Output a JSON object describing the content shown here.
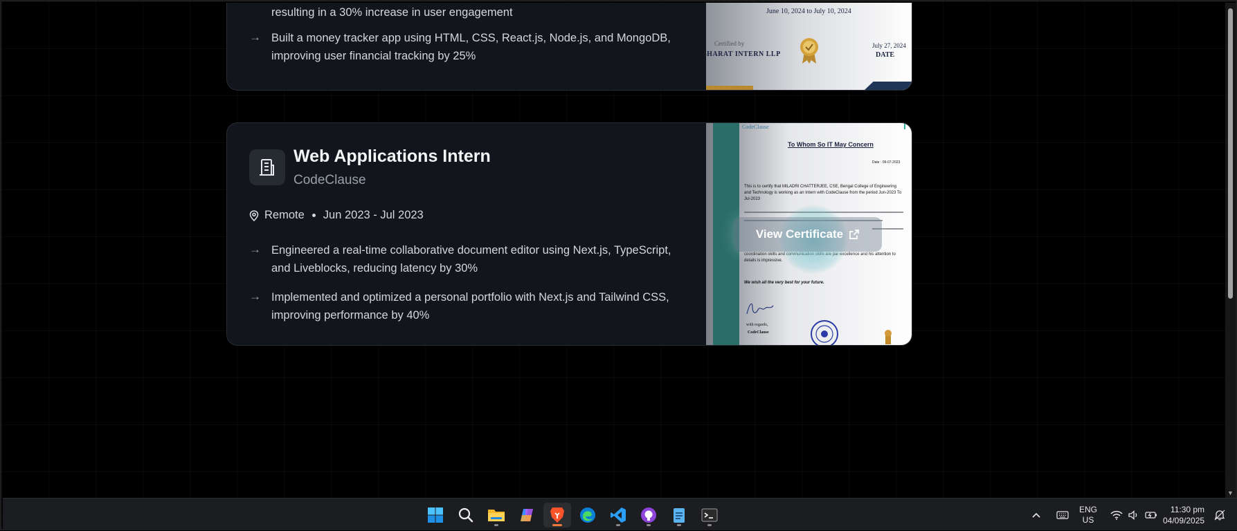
{
  "experience_prev": {
    "bullets": [
      "resulting in a 30% increase in user engagement",
      "Built a money tracker app using HTML, CSS, React.js, Node.js, and MongoDB, improving user financial tracking by 25%"
    ],
    "certificate": {
      "dates": "June 10, 2024 to July 10, 2024",
      "certified_by_label": "Certified by",
      "issuer": "BHARAT INTERN LLP",
      "date_value": "July 27, 2024",
      "date_label": "DATE"
    }
  },
  "experience": {
    "role": "Web Applications Intern",
    "company": "CodeClause",
    "location": "Remote",
    "period": "Jun 2023 - Jul 2023",
    "bullets": [
      "Engineered a real-time collaborative document editor using Next.js, TypeScript, and Liveblocks, reducing latency by 30%",
      "Implemented and optimized a personal portfolio with Next.js and Tailwind CSS, improving performance by 40%"
    ],
    "certificate": {
      "brand": "CodeClause",
      "heading": "To Whom So IT May Concern",
      "date_line": "Date : 09-07-2023",
      "body": "This is to certify that MILADRI CHATTERJEE, CSE, Bengal College of Engineering and Technology is working as an Intern with CodeClause from the period Jun-2023 To Jul-2023",
      "body2": "coordination skills and communication skills are par excellence and his attention to details is impressive.",
      "wish": "We wish all the very best for your future.",
      "regards": "with regards,",
      "signoff": "CodeClause",
      "view_label": "View Certificate"
    }
  },
  "taskbar": {
    "apps": [
      "start-button",
      "search",
      "file-explorer",
      "copilot",
      "brave-browser",
      "edge-browser",
      "vscode",
      "github-desktop",
      "notepad",
      "terminal"
    ],
    "active_app": "brave-browser",
    "lang_top": "ENG",
    "lang_bottom": "US",
    "time": "11:30 pm",
    "date": "04/09/2025"
  },
  "colors": {
    "card_bg": "#12151b",
    "accent_active": "#f0783c",
    "teal": "#2a6e6a"
  }
}
